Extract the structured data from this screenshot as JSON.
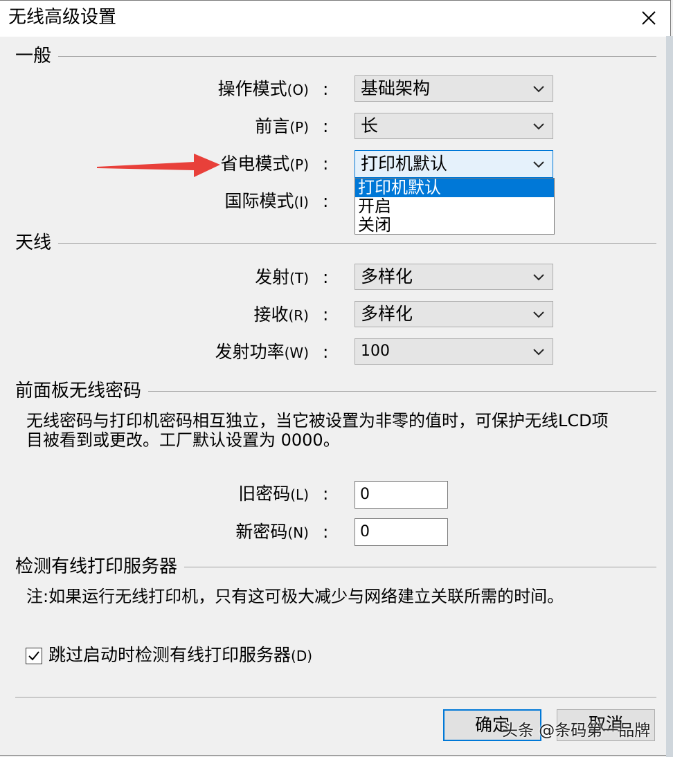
{
  "window": {
    "title": "无线高级设置",
    "close_label": "×"
  },
  "groups": {
    "general": {
      "title": "一般"
    },
    "antenna": {
      "title": "天线"
    },
    "panel_password": {
      "title": "前面板无线密码",
      "desc_line1": "无线密码与打印机密码相互独立，当它被设置为非零的值时，可保护无线LCD项",
      "desc_line2": "目被看到或更改。工厂默认设置为 0000。"
    },
    "detect": {
      "title": "检测有线打印服务器",
      "note": "注:如果运行无线打印机，只有这可极大减少与网络建立关联所需的时间。"
    }
  },
  "fields": {
    "operation_mode": {
      "label": "操作模式",
      "key": "(O)",
      "value": "基础架构"
    },
    "preamble": {
      "label": "前言",
      "key": "(P)",
      "value": "长"
    },
    "power_save": {
      "label": "省电模式",
      "key": "(P)",
      "value": "打印机默认",
      "options": [
        "打印机默认",
        "开启",
        "关闭"
      ]
    },
    "intl_mode": {
      "label": "国际模式",
      "key": "(I)"
    },
    "transmit": {
      "label": "发射",
      "key": "(T)",
      "value": "多样化"
    },
    "receive": {
      "label": "接收",
      "key": "(R)",
      "value": "多样化"
    },
    "tx_power": {
      "label": "发射功率",
      "key": "(W)",
      "value": "100"
    },
    "old_password": {
      "label": "旧密码",
      "key": "(L)",
      "value": "0"
    },
    "new_password": {
      "label": "新密码",
      "key": "(N)",
      "value": "0"
    },
    "colon": ":"
  },
  "skip_detect": {
    "label": "跳过启动时检测有线打印服务器",
    "key": "(D)",
    "checked": true
  },
  "buttons": {
    "ok": "确定",
    "cancel": "取消"
  },
  "watermark": "头条 @条码第一品牌",
  "colors": {
    "accent": "#0078d7",
    "arrow": "#e8403a"
  }
}
